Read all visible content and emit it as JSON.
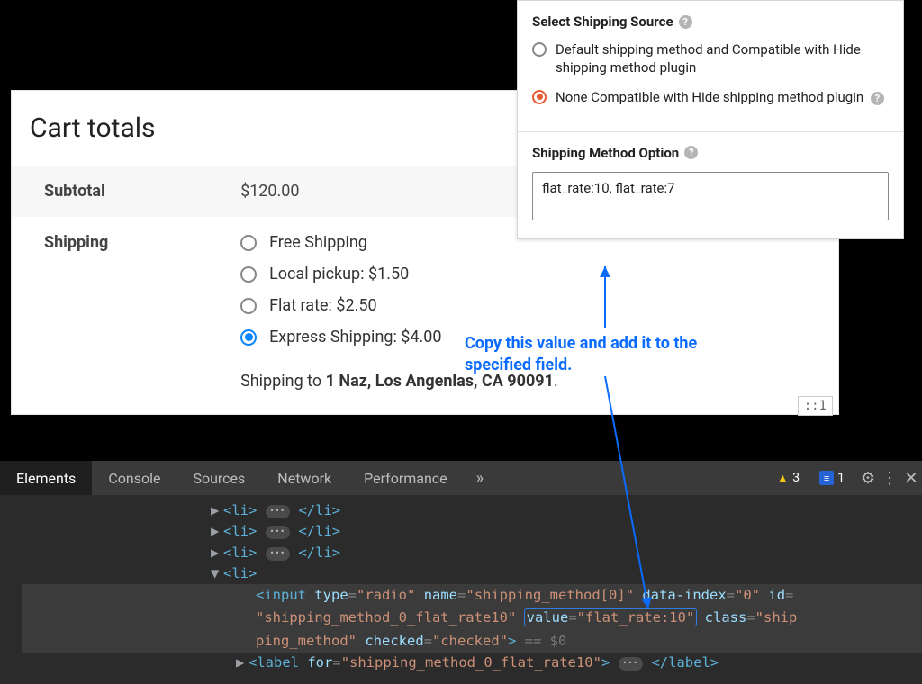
{
  "cart": {
    "title": "Cart totals",
    "subtotal_label": "Subtotal",
    "subtotal_value": "$120.00",
    "shipping_label": "Shipping",
    "options": [
      {
        "label": "Free Shipping",
        "checked": false
      },
      {
        "label": "Local pickup: $1.50",
        "checked": false
      },
      {
        "label": "Flat rate: $2.50",
        "checked": false
      },
      {
        "label": "Express Shipping: $4.00",
        "checked": true
      }
    ],
    "shipping_to_prefix": "Shipping to ",
    "shipping_to_address": "1 Naz, Los Angenlas, CA 90091",
    "pseudo_badge": "::1"
  },
  "settings": {
    "source_heading": "Select Shipping Source",
    "source_options": [
      {
        "label": "Default shipping method and Compatible with Hide shipping method plugin",
        "checked": false
      },
      {
        "label": "None Compatible with Hide shipping method plugin",
        "checked": true,
        "help": true
      }
    ],
    "method_heading": "Shipping Method Option",
    "method_value": "flat_rate:10, flat_rate:7"
  },
  "annotation": {
    "text": "Copy this value and add it to the specified field."
  },
  "devtools": {
    "tabs": [
      "Elements",
      "Console",
      "Sources",
      "Network",
      "Performance"
    ],
    "warn_count": "3",
    "msg_count": "1",
    "collapsed_li": "<li>",
    "collapsed_li_close": "</li>",
    "open_li": "<li>",
    "input_open": "<input",
    "attr_type_n": "type",
    "attr_type_v": "\"radio\"",
    "attr_name_n": "name",
    "attr_name_v": "\"shipping_method[0]\"",
    "attr_dindex_n": "data-index",
    "attr_dindex_v": "\"0\"",
    "attr_id_n": "id",
    "attr_id_v": "\"shipping_method_0_flat_rate10\"",
    "attr_value_n": "value",
    "attr_value_v": "\"flat_rate:10\"",
    "attr_class_n": "class",
    "attr_class_v": "\"shipping_method\"",
    "attr_checked_n": "checked",
    "attr_checked_v": "\"checked\"",
    "eq_sel": " == $0",
    "label_open": "<label",
    "attr_for_n": "for",
    "attr_for_v": "\"shipping_method_0_flat_rate10\"",
    "label_close": "</label>"
  }
}
